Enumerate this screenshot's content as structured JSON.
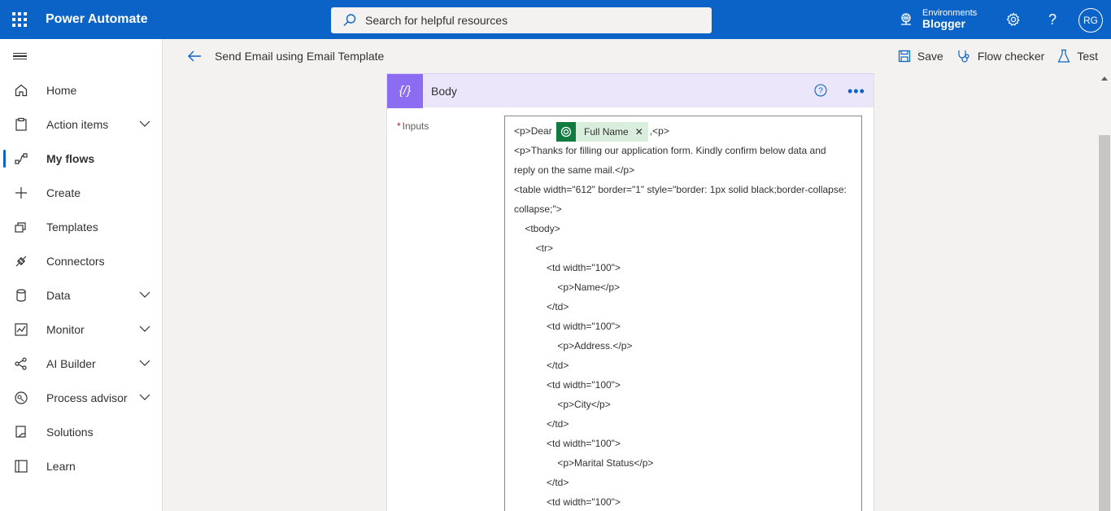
{
  "app": {
    "title": "Power Automate"
  },
  "search": {
    "placeholder": "Search for helpful resources"
  },
  "environment": {
    "label": "Environments",
    "name": "Blogger"
  },
  "user": {
    "initials": "RG"
  },
  "sidebar": {
    "items": [
      {
        "label": "Home",
        "icon": "home-icon",
        "chevron": false,
        "active": false
      },
      {
        "label": "Action items",
        "icon": "clipboard-icon",
        "chevron": true,
        "active": false
      },
      {
        "label": "My flows",
        "icon": "flow-icon",
        "chevron": false,
        "active": true
      },
      {
        "label": "Create",
        "icon": "plus-icon",
        "chevron": false,
        "active": false
      },
      {
        "label": "Templates",
        "icon": "templates-icon",
        "chevron": false,
        "active": false
      },
      {
        "label": "Connectors",
        "icon": "connector-icon",
        "chevron": false,
        "active": false
      },
      {
        "label": "Data",
        "icon": "database-icon",
        "chevron": true,
        "active": false
      },
      {
        "label": "Monitor",
        "icon": "monitor-icon",
        "chevron": true,
        "active": false
      },
      {
        "label": "AI Builder",
        "icon": "ai-builder-icon",
        "chevron": true,
        "active": false
      },
      {
        "label": "Process advisor",
        "icon": "process-advisor-icon",
        "chevron": true,
        "active": false
      },
      {
        "label": "Solutions",
        "icon": "solutions-icon",
        "chevron": false,
        "active": false
      },
      {
        "label": "Learn",
        "icon": "book-icon",
        "chevron": false,
        "active": false
      }
    ]
  },
  "commandbar": {
    "flow_title": "Send Email using Email Template",
    "save_label": "Save",
    "checker_label": "Flow checker",
    "test_label": "Test"
  },
  "card": {
    "title": "Body",
    "icon_text": "{/}",
    "inputs_label": "Inputs",
    "token_label": "Full Name",
    "first_line_before": "<p>Dear",
    "first_line_after": ",<p>",
    "lines": [
      "<p>Thanks for filling our application form. Kindly confirm below data and",
      "reply on the same mail.</p>",
      "<table width=\"612\" border=\"1\" style=\"border: 1px solid black;border-collapse:",
      "collapse;\">",
      "    <tbody>",
      "        <tr>",
      "            <td width=\"100\">",
      "                <p>Name</p>",
      "            </td>",
      "            <td width=\"100\">",
      "                <p>Address.</p>",
      "            </td>",
      "            <td width=\"100\">",
      "                <p>City</p>",
      "            </td>",
      "            <td width=\"100\">",
      "                <p>Marital Status</p>",
      "            </td>",
      "            <td width=\"100\">"
    ]
  },
  "colors": {
    "topbar": "#0b63c7",
    "accent": "#0b63c7",
    "card_header": "#ece6fb",
    "card_icon": "#8c6cf0",
    "token": "#117a3f"
  }
}
